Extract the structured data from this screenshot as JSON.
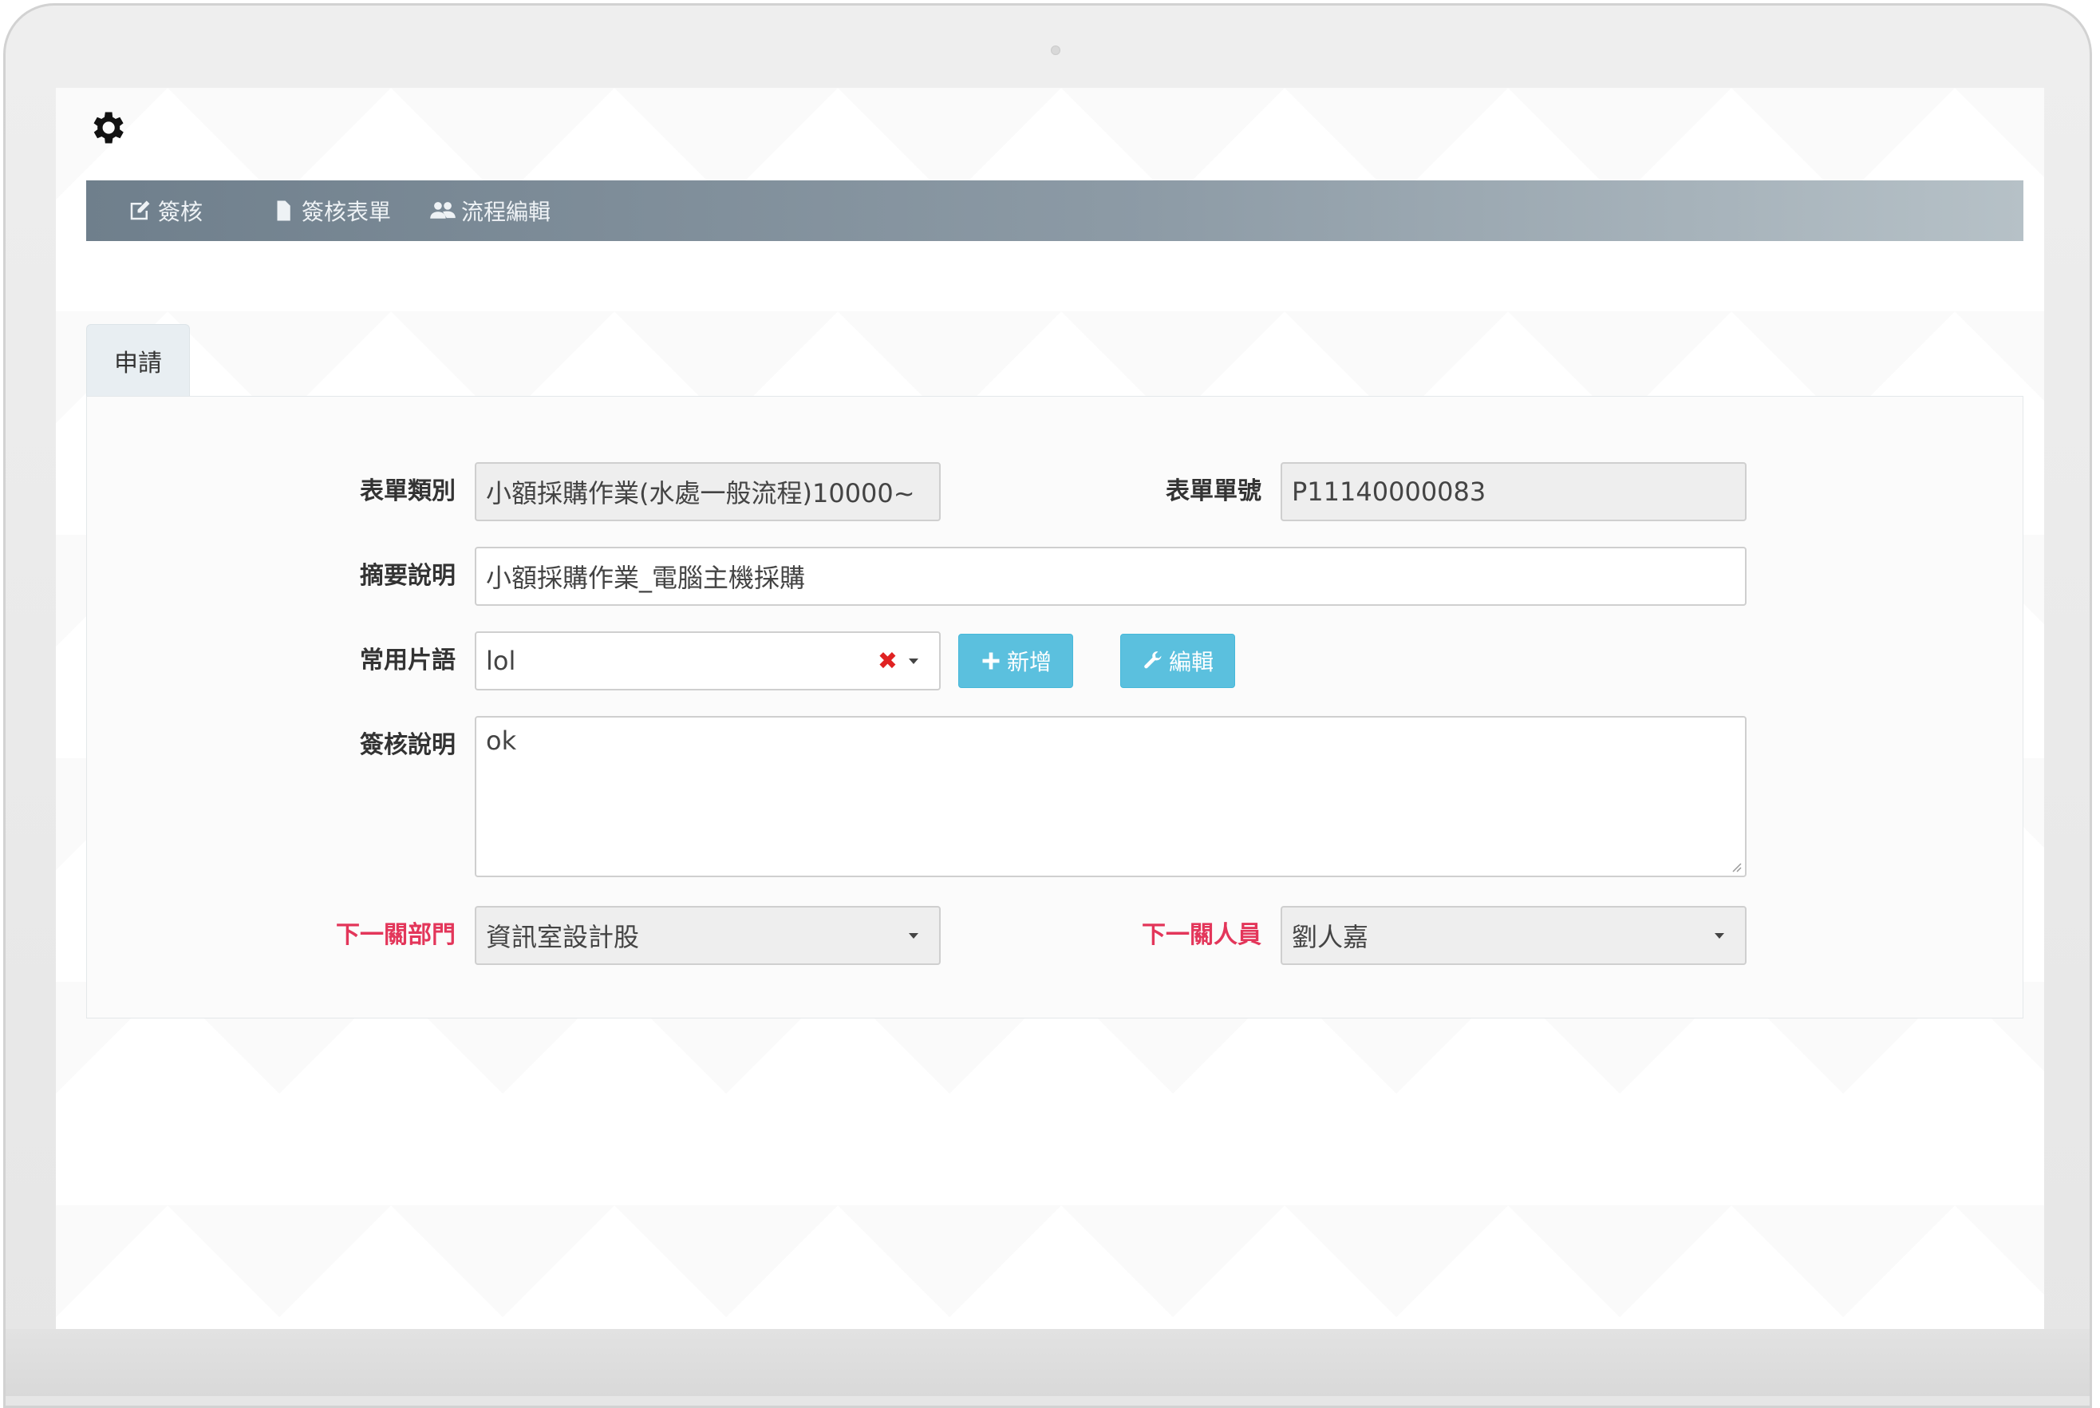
{
  "nav": {
    "items": [
      {
        "label": "簽核",
        "icon": "edit-icon"
      },
      {
        "label": "簽核表單",
        "icon": "file-icon"
      },
      {
        "label": "流程編輯",
        "icon": "users-icon"
      }
    ]
  },
  "tabs": [
    {
      "label": "申請"
    }
  ],
  "form": {
    "form_type": {
      "label": "表單類別",
      "value": "小額採購作業(水處一般流程)10000~"
    },
    "form_number": {
      "label": "表單單號",
      "value": "P11140000083"
    },
    "summary": {
      "label": "摘要說明",
      "value": "小額採購作業_電腦主機採購"
    },
    "phrase": {
      "label": "常用片語",
      "value": "lol",
      "clear": "✖"
    },
    "add_button": {
      "label": "新增"
    },
    "edit_button": {
      "label": "編輯"
    },
    "approval_note": {
      "label": "簽核說明",
      "value": "ok"
    },
    "next_dept": {
      "label": "下一關部門",
      "value": "資訊室設計股"
    },
    "next_person": {
      "label": "下一關人員",
      "value": "劉人嘉"
    }
  },
  "colors": {
    "accent": "#5bc0de",
    "required_label": "#e3365a",
    "navbar_start": "#6f7f8c",
    "navbar_end": "#b6c1c7"
  }
}
